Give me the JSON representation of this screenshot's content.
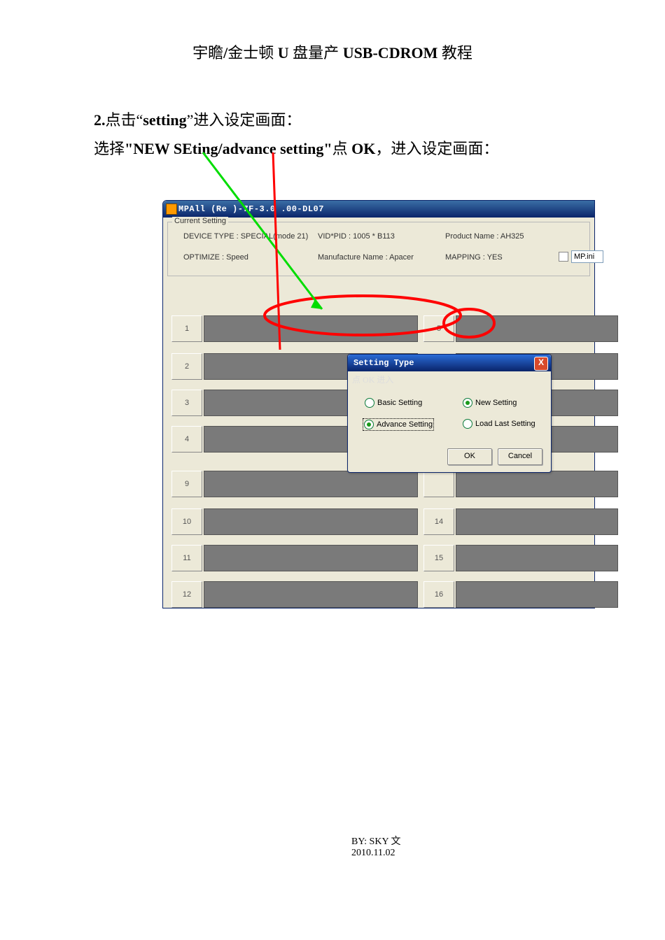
{
  "doc": {
    "title_cn_prefix": "宇瞻",
    "title_sep": "/",
    "title_cn_mid": "金士顿 ",
    "title_rom1": "U",
    "title_cn_mid2": " 盘量产 ",
    "title_rom2": "USB-CDROM",
    "title_cn_suffix": " 教程",
    "step_no": "2.",
    "step_text_a": "点击“",
    "step_word": "setting",
    "step_text_b": "”进入设定画面：",
    "sub_a": "选择",
    "sub_quote": "\"NEW SEting/advance setting\"",
    "sub_b": "点 ",
    "sub_ok": "OK",
    "sub_c": "，进入设定画面：",
    "byline": "BY: SKY 文",
    "date": "2010.11.02"
  },
  "app": {
    "title": "MPAll (Re )-7F-3.0 .00-DL07",
    "group_legend": "Current Setting",
    "device_type": "DEVICE TYPE : SPECIAL(mode 21)",
    "vid_pid": "VID*PID : 1005 * B113",
    "product": "Product Name : AH325",
    "optimize": "OPTIMIZE : Speed",
    "manufacture": "Manufacture Name : Apacer",
    "mapping": "MAPPING : YES",
    "ini": "MP.ini"
  },
  "slots": {
    "left": [
      "1",
      "2",
      "3",
      "4",
      "9",
      "10",
      "11",
      "12"
    ],
    "right": [
      "5",
      "",
      "",
      "",
      "",
      "14",
      "15",
      "16"
    ]
  },
  "dialog": {
    "title": "Setting Type",
    "hint": "点 OK 进入",
    "basic": "Basic Setting",
    "advance": "Advance Setting",
    "new": "New Setting",
    "load": "Load Last Setting",
    "ok": "OK",
    "cancel": "Cancel",
    "close": "X"
  }
}
